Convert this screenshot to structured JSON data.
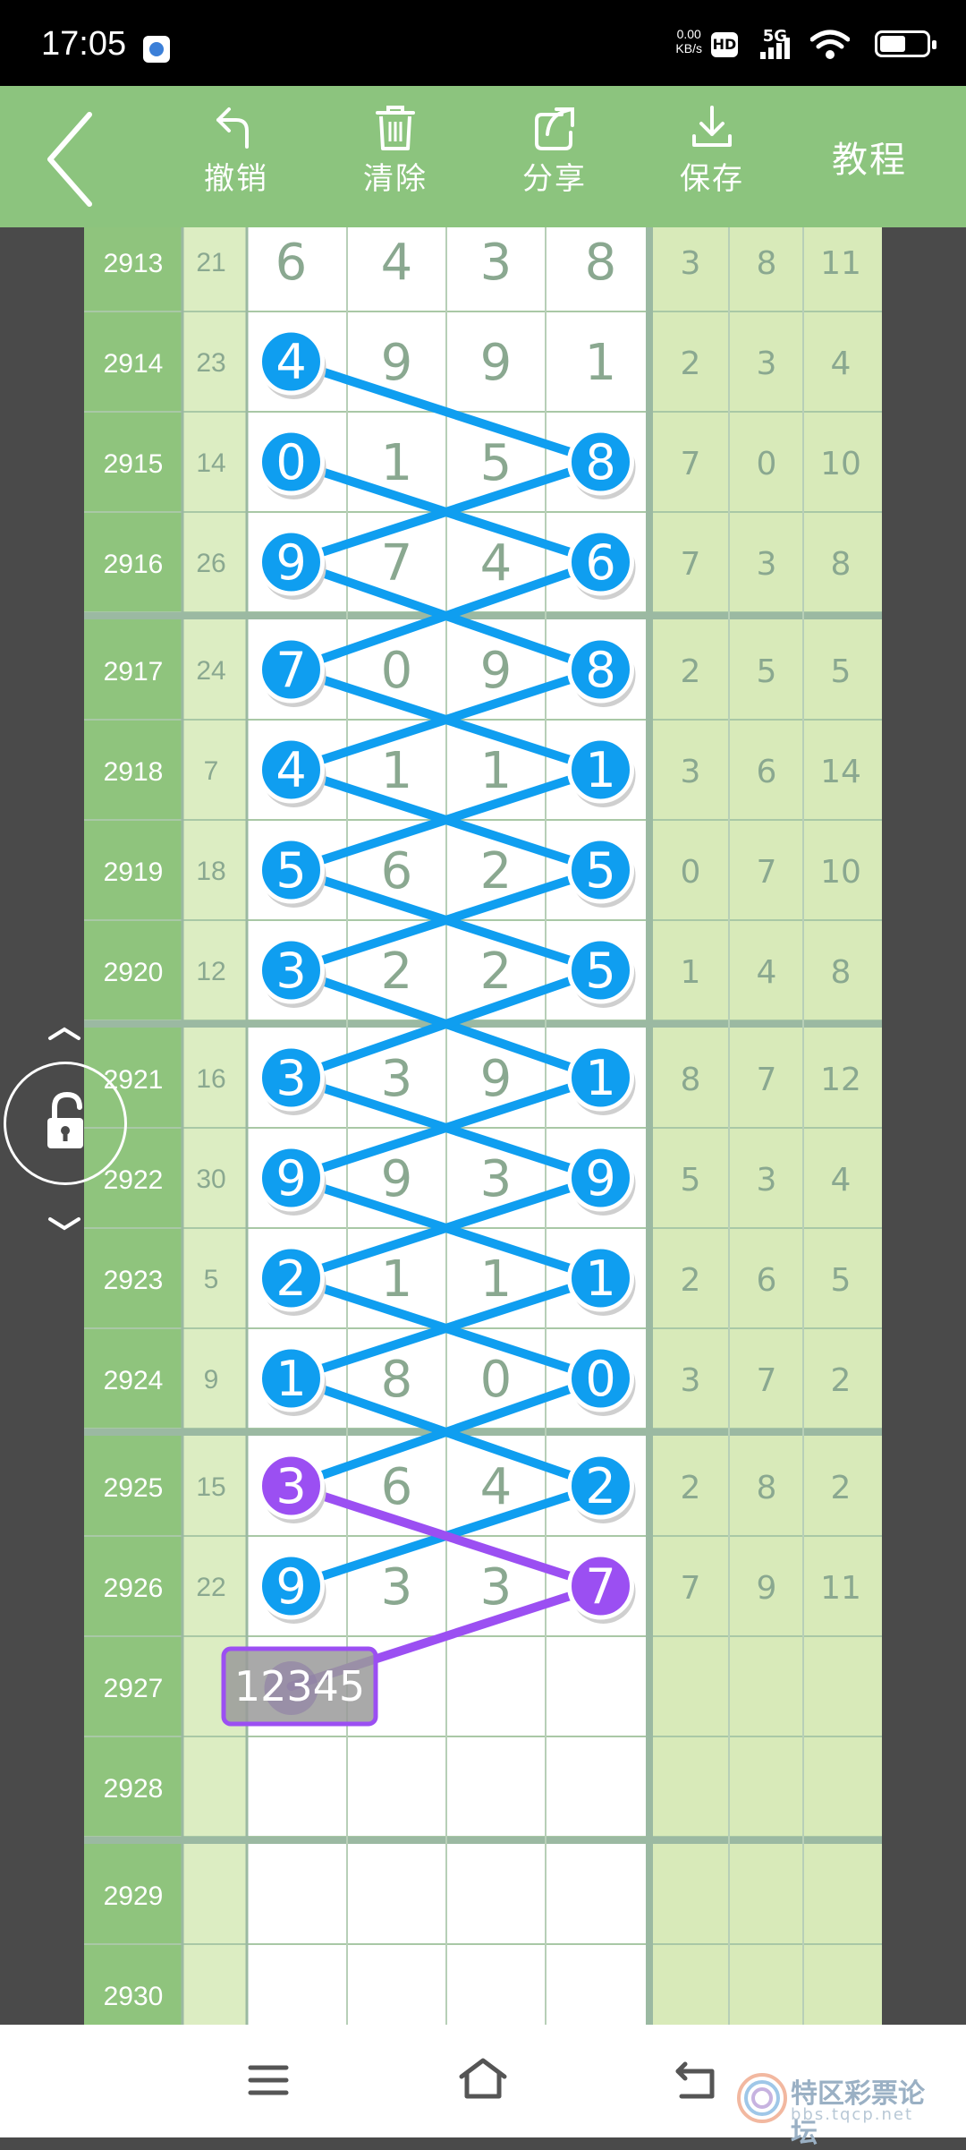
{
  "status": {
    "time": "17:05",
    "net_speed": "0.00",
    "net_unit": "KB/s",
    "hd": "HD",
    "signal": "5G"
  },
  "toolbar": {
    "undo": "撤销",
    "clear": "清除",
    "share": "分享",
    "save": "保存",
    "tutorial": "教程"
  },
  "rows": [
    {
      "id": "2913",
      "sum": "21",
      "digits": [
        "6",
        "4",
        "3",
        "8"
      ],
      "stats": [
        "3",
        "8",
        "11"
      ]
    },
    {
      "id": "2914",
      "sum": "23",
      "digits": [
        "4",
        "9",
        "9",
        "1"
      ],
      "stats": [
        "2",
        "3",
        "4"
      ]
    },
    {
      "id": "2915",
      "sum": "14",
      "digits": [
        "0",
        "1",
        "5",
        "8"
      ],
      "stats": [
        "7",
        "0",
        "10"
      ]
    },
    {
      "id": "2916",
      "sum": "26",
      "digits": [
        "9",
        "7",
        "4",
        "6"
      ],
      "stats": [
        "7",
        "3",
        "8"
      ]
    },
    {
      "id": "2917",
      "sum": "24",
      "digits": [
        "7",
        "0",
        "9",
        "8"
      ],
      "stats": [
        "2",
        "5",
        "5"
      ]
    },
    {
      "id": "2918",
      "sum": "7",
      "digits": [
        "4",
        "1",
        "1",
        "1"
      ],
      "stats": [
        "3",
        "6",
        "14"
      ]
    },
    {
      "id": "2919",
      "sum": "18",
      "digits": [
        "5",
        "6",
        "2",
        "5"
      ],
      "stats": [
        "0",
        "7",
        "10"
      ]
    },
    {
      "id": "2920",
      "sum": "12",
      "digits": [
        "3",
        "2",
        "2",
        "5"
      ],
      "stats": [
        "1",
        "4",
        "8"
      ]
    },
    {
      "id": "2921",
      "sum": "16",
      "digits": [
        "3",
        "3",
        "9",
        "1"
      ],
      "stats": [
        "8",
        "7",
        "12"
      ]
    },
    {
      "id": "2922",
      "sum": "30",
      "digits": [
        "9",
        "9",
        "3",
        "9"
      ],
      "stats": [
        "5",
        "3",
        "4"
      ]
    },
    {
      "id": "2923",
      "sum": "5",
      "digits": [
        "2",
        "1",
        "1",
        "1"
      ],
      "stats": [
        "2",
        "6",
        "5"
      ]
    },
    {
      "id": "2924",
      "sum": "9",
      "digits": [
        "1",
        "8",
        "0",
        "0"
      ],
      "stats": [
        "3",
        "7",
        "2"
      ]
    },
    {
      "id": "2925",
      "sum": "15",
      "digits": [
        "3",
        "6",
        "4",
        "2"
      ],
      "stats": [
        "2",
        "8",
        "2"
      ]
    },
    {
      "id": "2926",
      "sum": "22",
      "digits": [
        "9",
        "3",
        "3",
        "7"
      ],
      "stats": [
        "7",
        "9",
        "11"
      ]
    },
    {
      "id": "2927",
      "sum": "",
      "digits": [
        "",
        "",
        "",
        ""
      ],
      "stats": [
        "",
        "",
        ""
      ]
    },
    {
      "id": "2928",
      "sum": "",
      "digits": [
        "",
        "",
        "",
        ""
      ],
      "stats": [
        "",
        "",
        ""
      ]
    },
    {
      "id": "2929",
      "sum": "",
      "digits": [
        "",
        "",
        "",
        ""
      ],
      "stats": [
        "",
        "",
        ""
      ]
    },
    {
      "id": "2930",
      "sum": "",
      "digits": [
        "",
        "",
        "",
        ""
      ],
      "stats": [
        "",
        "",
        ""
      ]
    }
  ],
  "marks": [
    {
      "row": 1,
      "col": 0,
      "color": "blue"
    },
    {
      "row": 2,
      "col": 0,
      "color": "blue"
    },
    {
      "row": 2,
      "col": 3,
      "color": "blue"
    },
    {
      "row": 3,
      "col": 0,
      "color": "blue"
    },
    {
      "row": 3,
      "col": 3,
      "color": "blue"
    },
    {
      "row": 4,
      "col": 0,
      "color": "blue"
    },
    {
      "row": 4,
      "col": 3,
      "color": "blue"
    },
    {
      "row": 5,
      "col": 0,
      "color": "blue"
    },
    {
      "row": 5,
      "col": 3,
      "color": "blue"
    },
    {
      "row": 6,
      "col": 0,
      "color": "blue"
    },
    {
      "row": 6,
      "col": 3,
      "color": "blue"
    },
    {
      "row": 7,
      "col": 0,
      "color": "blue"
    },
    {
      "row": 7,
      "col": 3,
      "color": "blue"
    },
    {
      "row": 8,
      "col": 0,
      "color": "blue"
    },
    {
      "row": 8,
      "col": 3,
      "color": "blue"
    },
    {
      "row": 9,
      "col": 0,
      "color": "blue"
    },
    {
      "row": 9,
      "col": 3,
      "color": "blue"
    },
    {
      "row": 10,
      "col": 0,
      "color": "blue"
    },
    {
      "row": 10,
      "col": 3,
      "color": "blue"
    },
    {
      "row": 11,
      "col": 0,
      "color": "blue"
    },
    {
      "row": 11,
      "col": 3,
      "color": "blue"
    },
    {
      "row": 12,
      "col": 0,
      "color": "purple"
    },
    {
      "row": 12,
      "col": 3,
      "color": "blue"
    },
    {
      "row": 13,
      "col": 0,
      "color": "blue"
    },
    {
      "row": 13,
      "col": 3,
      "color": "purple"
    }
  ],
  "lines": [
    {
      "from": [
        1,
        0
      ],
      "to": [
        2,
        3
      ],
      "color": "blue"
    },
    {
      "from": [
        2,
        0
      ],
      "to": [
        3,
        3
      ],
      "color": "blue"
    },
    {
      "from": [
        2,
        3
      ],
      "to": [
        3,
        0
      ],
      "color": "blue"
    },
    {
      "from": [
        3,
        0
      ],
      "to": [
        4,
        3
      ],
      "color": "blue"
    },
    {
      "from": [
        3,
        3
      ],
      "to": [
        4,
        0
      ],
      "color": "blue"
    },
    {
      "from": [
        4,
        0
      ],
      "to": [
        5,
        3
      ],
      "color": "blue"
    },
    {
      "from": [
        4,
        3
      ],
      "to": [
        5,
        0
      ],
      "color": "blue"
    },
    {
      "from": [
        5,
        0
      ],
      "to": [
        6,
        3
      ],
      "color": "blue"
    },
    {
      "from": [
        5,
        3
      ],
      "to": [
        6,
        0
      ],
      "color": "blue"
    },
    {
      "from": [
        6,
        0
      ],
      "to": [
        7,
        3
      ],
      "color": "blue"
    },
    {
      "from": [
        6,
        3
      ],
      "to": [
        7,
        0
      ],
      "color": "blue"
    },
    {
      "from": [
        7,
        0
      ],
      "to": [
        8,
        3
      ],
      "color": "blue"
    },
    {
      "from": [
        7,
        3
      ],
      "to": [
        8,
        0
      ],
      "color": "blue"
    },
    {
      "from": [
        8,
        0
      ],
      "to": [
        9,
        3
      ],
      "color": "blue"
    },
    {
      "from": [
        8,
        3
      ],
      "to": [
        9,
        0
      ],
      "color": "blue"
    },
    {
      "from": [
        9,
        0
      ],
      "to": [
        10,
        3
      ],
      "color": "blue"
    },
    {
      "from": [
        9,
        3
      ],
      "to": [
        10,
        0
      ],
      "color": "blue"
    },
    {
      "from": [
        10,
        0
      ],
      "to": [
        11,
        3
      ],
      "color": "blue"
    },
    {
      "from": [
        10,
        3
      ],
      "to": [
        11,
        0
      ],
      "color": "blue"
    },
    {
      "from": [
        11,
        0
      ],
      "to": [
        12,
        3
      ],
      "color": "blue"
    },
    {
      "from": [
        11,
        3
      ],
      "to": [
        12,
        0
      ],
      "color": "blue"
    },
    {
      "from": [
        12,
        3
      ],
      "to": [
        13,
        0
      ],
      "color": "blue"
    },
    {
      "from": [
        12,
        0
      ],
      "to": [
        13,
        3
      ],
      "color": "purple"
    },
    {
      "from": [
        13,
        3
      ],
      "to": [
        14,
        0
      ],
      "color": "purple"
    }
  ],
  "selector": {
    "row": 14,
    "text": "12345"
  },
  "colors": {
    "header": "#8cc47e",
    "blue": "#0f9ef0",
    "purple": "#9b4ff2",
    "digit": "#8aa890",
    "cellA": "#d6ebb7",
    "idcol": "#8fc47d"
  }
}
